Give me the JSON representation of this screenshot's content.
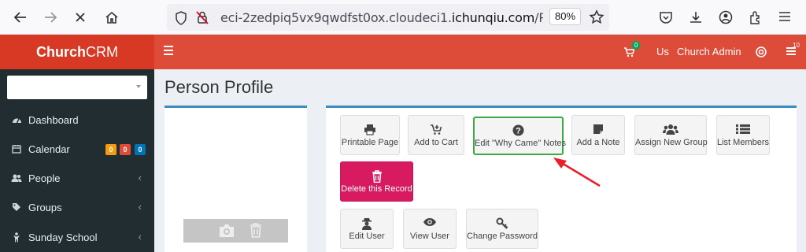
{
  "browser": {
    "url_prefix": "eci-2zedpiq5vx9qwdfst0ox.cloudeci1.",
    "url_domain": "ichunqiu.com",
    "url_suffix": "/Person",
    "zoom": "80%"
  },
  "header": {
    "brand_bold": "Church",
    "brand_rest": "CRM",
    "cart_count": "0",
    "user_initials": "Us",
    "user_name": "Church Admin",
    "tasks_count": "10"
  },
  "sidebar": {
    "items": [
      {
        "label": "Dashboard",
        "icon": "dashboard-icon"
      },
      {
        "label": "Calendar",
        "icon": "calendar-icon",
        "badges": [
          "0",
          "0",
          "0"
        ]
      },
      {
        "label": "People",
        "icon": "people-icon"
      },
      {
        "label": "Groups",
        "icon": "tag-icon"
      },
      {
        "label": "Sunday School",
        "icon": "child-icon"
      }
    ]
  },
  "page": {
    "title": "Person Profile"
  },
  "actions": {
    "printable_page": "Printable Page",
    "add_to_cart": "Add to Cart",
    "edit_why_came": "Edit \"Why Came\" Notes",
    "add_note": "Add a Note",
    "assign_group": "Assign New Group",
    "list_members": "List Members",
    "delete_record": "Delete this Record",
    "edit_user": "Edit User",
    "view_user": "View User",
    "change_password": "Change Password"
  },
  "colors": {
    "header": "#dd4b39",
    "sidebar": "#222d32",
    "danger": "#d81b60",
    "highlight": "#3aaa45",
    "annotation_arrow": "#e8202a"
  }
}
